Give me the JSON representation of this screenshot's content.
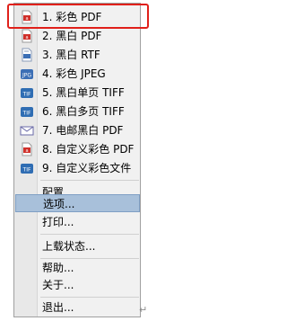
{
  "menu": {
    "items": [
      {
        "label": "1. 彩色 PDF",
        "icon": "pdf-icon"
      },
      {
        "label": "2. 黑白 PDF",
        "icon": "pdf-icon"
      },
      {
        "label": "3. 黑白 RTF",
        "icon": "rtf-icon"
      },
      {
        "label": "4. 彩色 JPEG",
        "icon": "jpeg-icon"
      },
      {
        "label": "5. 黑白单页 TIFF",
        "icon": "tiff-icon"
      },
      {
        "label": "6. 黑白多页 TIFF",
        "icon": "tiff-icon"
      },
      {
        "label": "7. 电邮黑白 PDF",
        "icon": "email-icon"
      },
      {
        "label": "8. 自定义彩色 PDF",
        "icon": "pdf-icon"
      },
      {
        "label": "9. 自定义彩色文件",
        "icon": "tiff-icon"
      }
    ],
    "configure": "配置...",
    "options": "选项...",
    "print": "打印...",
    "upload_status": "上载状态...",
    "help": "帮助...",
    "about": "关于...",
    "exit": "退出..."
  },
  "return_mark": "↵",
  "colors": {
    "highlight": "#a8c0da",
    "red_frame": "#e0201a",
    "pdf_red": "#d0302a",
    "blue_icon": "#3c6fb5",
    "tiff_blue": "#2f6db3",
    "email_purple": "#6a6aa8"
  }
}
